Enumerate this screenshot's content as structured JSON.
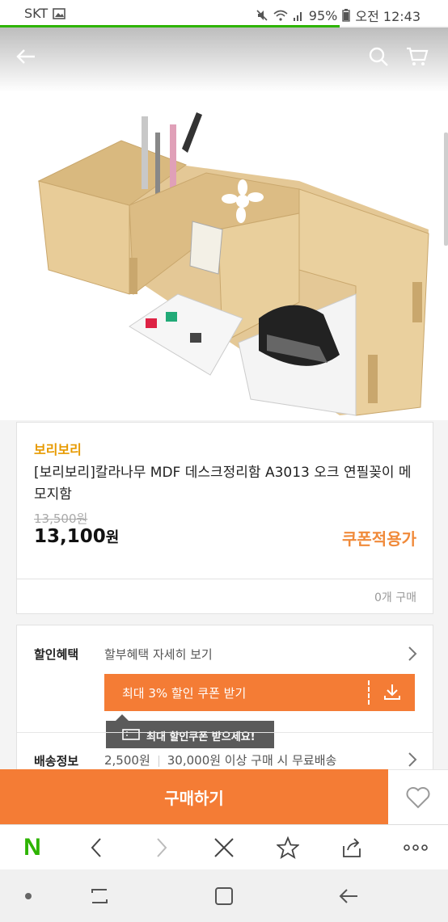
{
  "status_bar": {
    "carrier": "SKT",
    "battery": "95%",
    "time": "오전 12:43"
  },
  "product": {
    "brand": "보리보리",
    "title": "[보리보리]칼라나무 MDF 데스크정리함 A3013 오크 연필꽂이 메모지함",
    "original_price": "13,500원",
    "price": "13,100",
    "price_unit": "원",
    "coupon_label": "쿠폰적용가",
    "purchase_count": "0개 구매"
  },
  "benefits": {
    "label": "할인혜택",
    "installment_text": "할부혜택 자세히 보기",
    "coupon_button": "최대 3% 할인 쿠폰 받기",
    "tooltip": "최대 할인쿠폰 받으세요!"
  },
  "shipping": {
    "label": "배송정보",
    "fee": "2,500원",
    "free_condition": "30,000원 이상 구매 시 무료배송"
  },
  "buy_bar": {
    "buy_label": "구매하기"
  },
  "browser_toolbar": {
    "logo": "N"
  },
  "colors": {
    "accent": "#f47c35",
    "brand_yellow": "#e79a00",
    "naver_green": "#2db400"
  },
  "icons": [
    "back-arrow-icon",
    "search-icon",
    "cart-icon",
    "chevron-right-icon",
    "download-icon",
    "coupon-ticket-icon",
    "heart-icon",
    "close-icon",
    "star-icon",
    "share-icon",
    "more-icon"
  ]
}
